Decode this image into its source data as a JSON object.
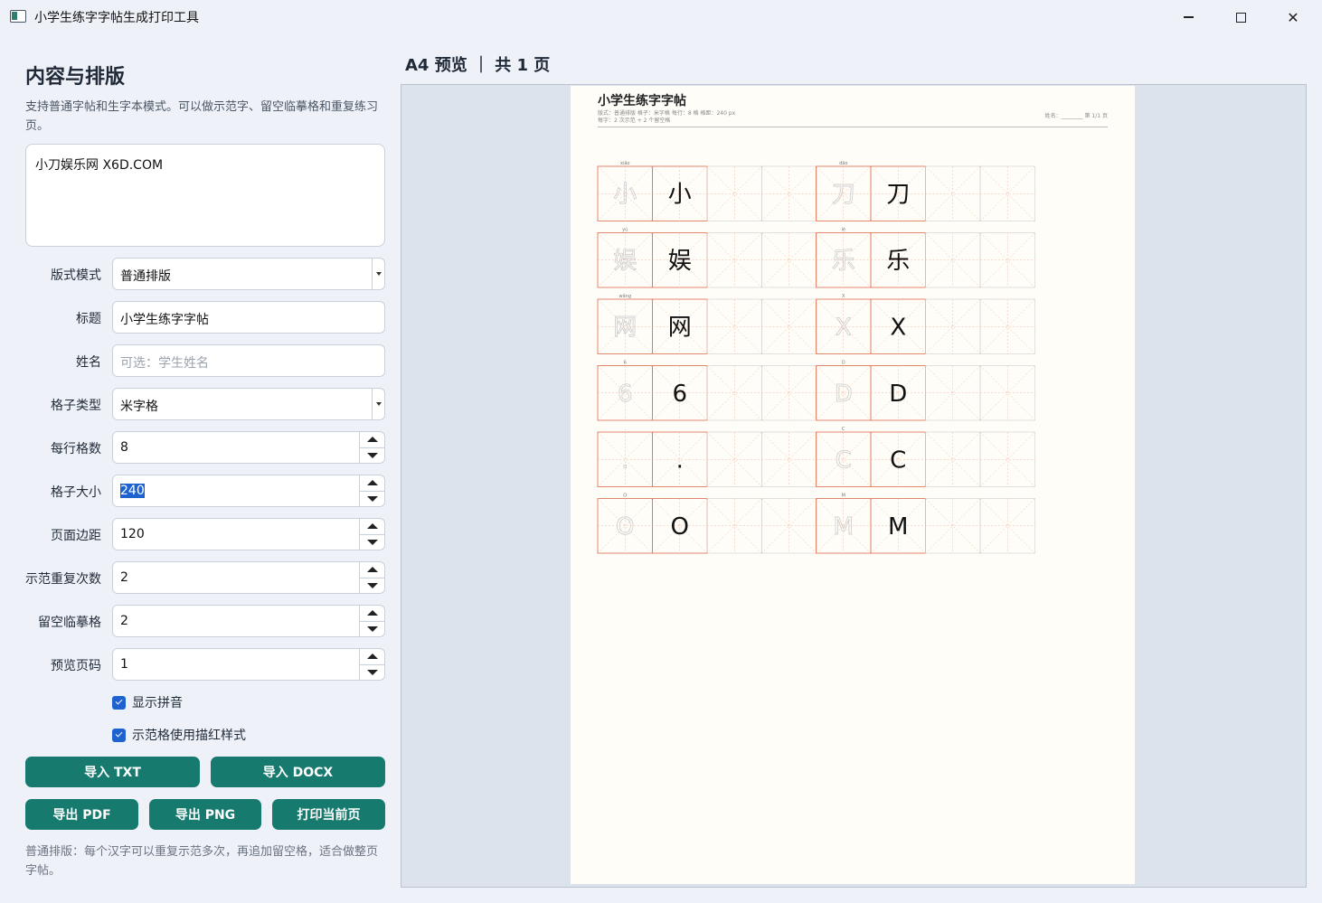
{
  "window": {
    "title": "小学生练字字帖生成打印工具"
  },
  "left_panel": {
    "heading": "内容与排版",
    "description": "支持普通字帖和生字本模式。可以做示范字、留空临摹格和重复练习页。",
    "content_text": "小刀娱乐网 X6D.COM",
    "fields": {
      "layout_mode": {
        "label": "版式模式",
        "value": "普通排版"
      },
      "title": {
        "label": "标题",
        "value": "小学生练字字帖"
      },
      "name": {
        "label": "姓名",
        "placeholder": "可选：学生姓名",
        "value": ""
      },
      "grid_type": {
        "label": "格子类型",
        "value": "米字格"
      },
      "cells_per_row": {
        "label": "每行格数",
        "value": "8"
      },
      "cell_size": {
        "label": "格子大小",
        "value": "240"
      },
      "page_margin": {
        "label": "页面边距",
        "value": "120"
      },
      "demo_repeat": {
        "label": "示范重复次数",
        "value": "2"
      },
      "blank_practice": {
        "label": "留空临摹格",
        "value": "2"
      },
      "preview_page": {
        "label": "预览页码",
        "value": "1"
      }
    },
    "checkboxes": {
      "show_pinyin": {
        "label": "显示拼音",
        "checked": true
      },
      "trace_style": {
        "label": "示范格使用描红样式",
        "checked": true
      }
    },
    "buttons": {
      "import_txt": "导入 TXT",
      "import_docx": "导入 DOCX",
      "export_pdf": "导出 PDF",
      "export_png": "导出 PNG",
      "print_page": "打印当前页"
    },
    "footer_note": "普通排版：每个汉字可以重复示范多次，再追加留空格，适合做整页字帖。"
  },
  "preview": {
    "title": "A4 预览 ｜ 共 1 页",
    "sheet": {
      "title": "小学生练字字帖",
      "meta_line1": "版式：普通排版   格子：米字格   每行：8 格   格距：240 px",
      "meta_line2": "每字：2 次示范 + 2 个留空格",
      "name_line": "姓名：________    第 1/1 页",
      "characters": [
        {
          "char": "小",
          "pinyin": "xiǎo"
        },
        {
          "char": "刀",
          "pinyin": "dāo"
        },
        {
          "char": "娱",
          "pinyin": "yú"
        },
        {
          "char": "乐",
          "pinyin": "lè"
        },
        {
          "char": "网",
          "pinyin": "wǎng"
        },
        {
          "char": "X",
          "pinyin": "X"
        },
        {
          "char": "6",
          "pinyin": "6"
        },
        {
          "char": "D",
          "pinyin": "D"
        },
        {
          "char": ".",
          "pinyin": "."
        },
        {
          "char": "C",
          "pinyin": "C"
        },
        {
          "char": "O",
          "pinyin": "O"
        },
        {
          "char": "M",
          "pinyin": "M"
        }
      ]
    }
  },
  "colors": {
    "accent_button": "#167a6e",
    "selection": "#1e62d0",
    "grid_line": "#e07a5f",
    "grid_guide": "#f0b8a4"
  }
}
